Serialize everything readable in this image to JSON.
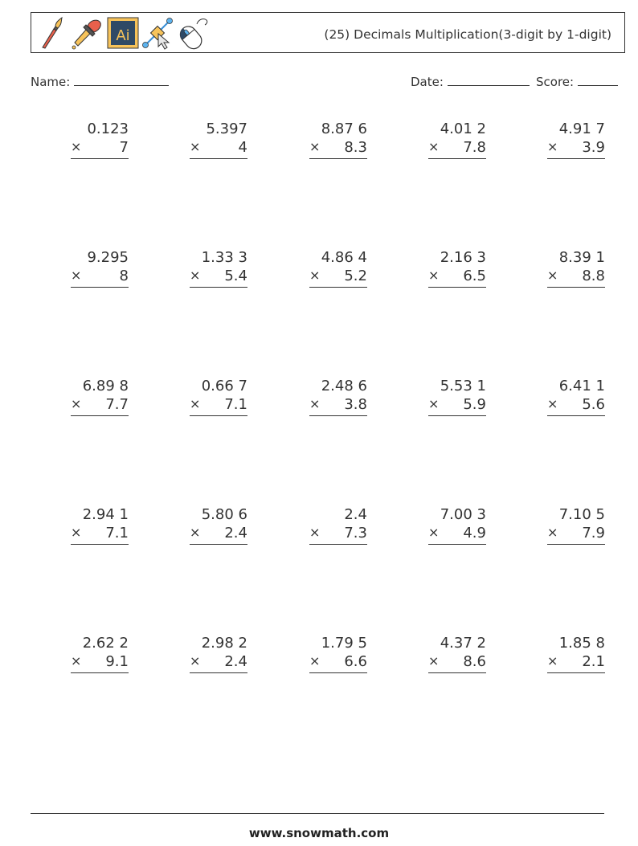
{
  "header": {
    "title": "(25) Decimals Multiplication(3-digit by 1-digit)",
    "icons": [
      "paintbrush-icon",
      "eyedropper-icon",
      "illustrator-icon",
      "vector-pen-icon",
      "mouse-icon"
    ]
  },
  "fields": {
    "name_label": "Name:",
    "date_label": "Date:",
    "score_label": "Score:"
  },
  "operator": "×",
  "problems": [
    [
      {
        "top": "0.123",
        "bottom": "7"
      },
      {
        "top": "5.397",
        "bottom": "4"
      },
      {
        "top": "8.87 6",
        "bottom": "8.3"
      },
      {
        "top": "4.01 2",
        "bottom": "7.8"
      },
      {
        "top": "4.91 7",
        "bottom": "3.9"
      }
    ],
    [
      {
        "top": "9.295",
        "bottom": "8"
      },
      {
        "top": "1.33 3",
        "bottom": "5.4"
      },
      {
        "top": "4.86 4",
        "bottom": "5.2"
      },
      {
        "top": "2.16 3",
        "bottom": "6.5"
      },
      {
        "top": "8.39 1",
        "bottom": "8.8"
      }
    ],
    [
      {
        "top": "6.89 8",
        "bottom": "7.7"
      },
      {
        "top": "0.66 7",
        "bottom": "7.1"
      },
      {
        "top": "2.48 6",
        "bottom": "3.8"
      },
      {
        "top": "5.53 1",
        "bottom": "5.9"
      },
      {
        "top": "6.41 1",
        "bottom": "5.6"
      }
    ],
    [
      {
        "top": "2.94 1",
        "bottom": "7.1"
      },
      {
        "top": "5.80 6",
        "bottom": "2.4"
      },
      {
        "top": "2.4",
        "bottom": "7.3"
      },
      {
        "top": "7.00 3",
        "bottom": "4.9"
      },
      {
        "top": "7.10 5",
        "bottom": "7.9"
      }
    ],
    [
      {
        "top": "2.62 2",
        "bottom": "9.1"
      },
      {
        "top": "2.98 2",
        "bottom": "2.4"
      },
      {
        "top": "1.79 5",
        "bottom": "6.6"
      },
      {
        "top": "4.37 2",
        "bottom": "8.6"
      },
      {
        "top": "1.85 8",
        "bottom": "2.1"
      }
    ]
  ],
  "footer": {
    "text": "www.snowmath.com"
  }
}
